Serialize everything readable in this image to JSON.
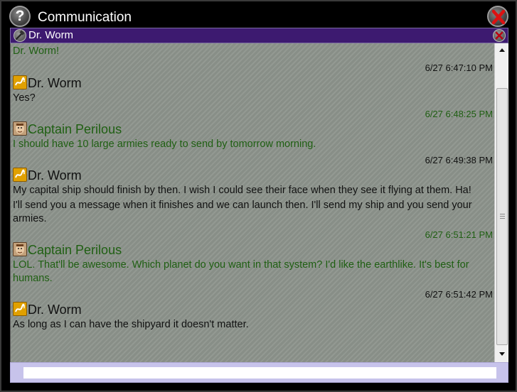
{
  "window": {
    "title": "Communication",
    "help_label": "?"
  },
  "tab": {
    "label": "Dr. Worm"
  },
  "colors": {
    "green_text": "#1f5f12",
    "dark_text": "#111111",
    "tab_bar": "#3d1a70",
    "input_bar": "#c7c3eb",
    "message_bg": "#8d948c"
  },
  "messages": {
    "partial_first_line": "Dr. Worm!",
    "entries": [
      {
        "time": "6/27 6:47:10 PM",
        "sender": "Dr. Worm",
        "lines": [
          "Yes?"
        ]
      },
      {
        "time": "6/27 6:48:25 PM",
        "sender": "Captain Perilous",
        "lines": [
          "I should have 10 large armies ready to send by tomorrow morning."
        ]
      },
      {
        "time": "6/27 6:49:38 PM",
        "sender": "Dr. Worm",
        "lines": [
          "My capital ship should finish by then. I wish I could see their face when they see it flying at them. Ha!",
          "I'll send you a message when it finishes and we can launch then. I'll send my ship and you send your armies."
        ]
      },
      {
        "time": "6/27 6:51:21 PM",
        "sender": "Captain Perilous",
        "lines": [
          "LOL. That'll be awesome. Which planet do you want in that system? I'd like the earthlike. It's best for humans."
        ]
      },
      {
        "time": "6/27 6:51:42 PM",
        "sender": "Dr. Worm",
        "lines": [
          "As long as I can have the shipyard it doesn't matter."
        ]
      }
    ]
  },
  "input": {
    "value": ""
  }
}
